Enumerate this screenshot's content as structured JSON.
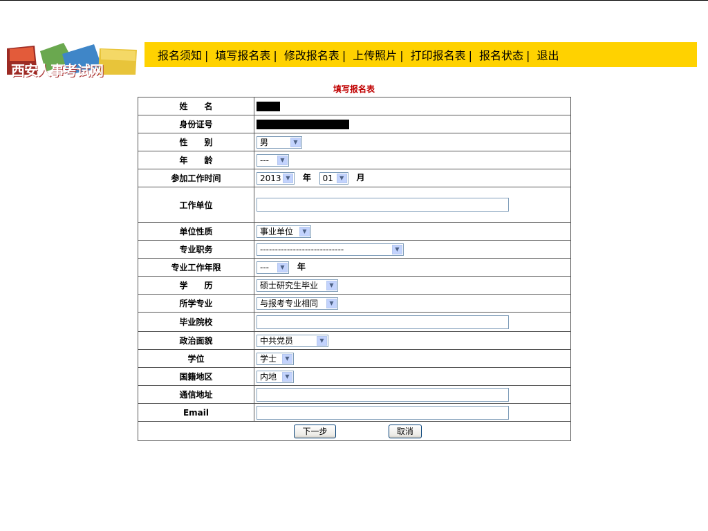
{
  "site": {
    "logo_text": "西安人事考试网"
  },
  "nav": [
    "报名须知",
    "填写报名表",
    "修改报名表",
    "上传照片",
    "打印报名表",
    "报名状态",
    "退出"
  ],
  "nav_separator": "|",
  "form": {
    "title": "填写报名表",
    "labels": {
      "name": "姓　　名",
      "id_number": "身份证号",
      "gender": "性　　别",
      "age": "年　　龄",
      "work_start": "参加工作时间",
      "employer": "工作单位",
      "employer_type": "单位性质",
      "professional_title": "专业职务",
      "years_in_profession": "专业工作年限",
      "education": "学　　历",
      "major": "所学专业",
      "school": "毕业院校",
      "political_status": "政治面貌",
      "degree": "学位",
      "nationality_region": "国籍地区",
      "address": "通信地址",
      "email": "Email"
    },
    "values": {
      "gender": "男",
      "age": "---",
      "work_year": "2013",
      "work_month": "01",
      "employer_type": "事业单位",
      "professional_title": "----------------------------",
      "years_in_profession": "---",
      "education": "硕士研究生毕业",
      "major": "与报考专业相同",
      "political_status": "中共党员",
      "degree": "学士",
      "nationality_region": "内地",
      "employer": "",
      "school": "",
      "address": "",
      "email": ""
    },
    "units": {
      "year": "年",
      "month": "月",
      "years": "年"
    },
    "buttons": {
      "next": "下一步",
      "cancel": "取消"
    }
  },
  "colors": {
    "nav_bg": "#FFD200",
    "title": "#C00000"
  }
}
